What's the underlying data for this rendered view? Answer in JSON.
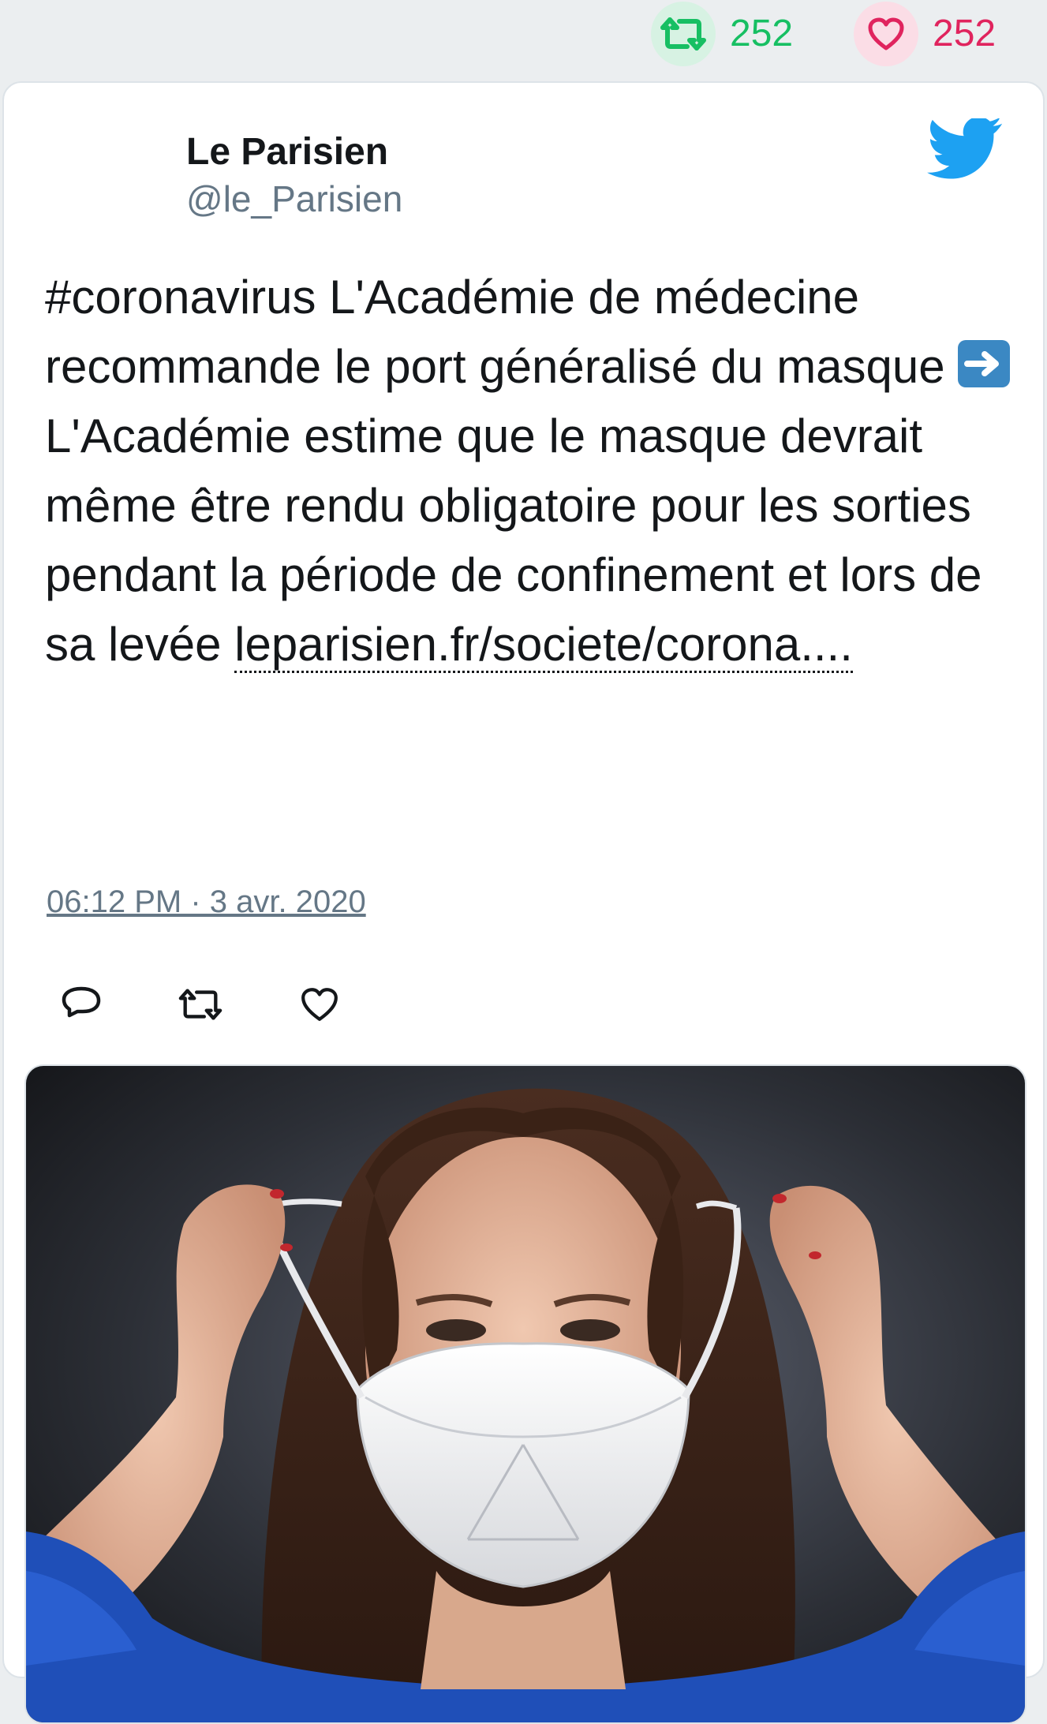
{
  "top_stats": {
    "retweet_count": "252",
    "like_count": "252"
  },
  "tweet": {
    "author_name": "Le Parisien",
    "author_handle": "@le_Parisien",
    "text_part1": "#coronavirus L'Académie de médecine recommande le port généralisé du masque ",
    "text_part2": " L'Académie estime que le masque devrait même être rendu obligatoire pour les sorties pendant la période de confinement et lors de sa levée ",
    "link_text": "leparisien.fr/societe/corona....",
    "timestamp": "06:12 PM · 3 avr. 2020"
  },
  "icons": {
    "retweet": "retweet-icon",
    "like": "heart-icon",
    "reply": "reply-icon",
    "brand": "twitter-bird-icon",
    "arrow_emoji": "right-arrow-emoji-icon"
  },
  "colors": {
    "retweet_green": "#17bf63",
    "like_red": "#e0245e",
    "twitter_blue": "#1da1f2",
    "secondary_text": "#657786"
  }
}
